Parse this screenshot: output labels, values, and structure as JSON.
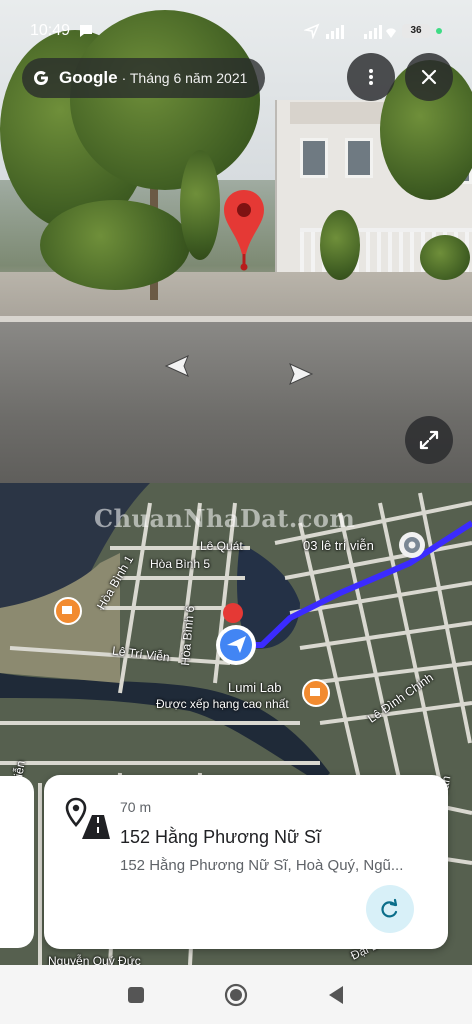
{
  "status_bar": {
    "time": "10:49",
    "battery": "36"
  },
  "streetview": {
    "brand": "Google",
    "date": "· Tháng 6 năm 2021",
    "icons": {
      "menu": "more-vert-icon",
      "close": "close-icon",
      "expand": "expand-icon",
      "pin": "location-pin-icon",
      "nav_left": "chevron-left-icon",
      "nav_right": "chevron-right-icon"
    }
  },
  "map": {
    "watermark": "ChuanNhaDat.com",
    "route_color": "#3b2bff",
    "labels": {
      "le_quat": "Lê Quát",
      "hoa_binh_5": "Hòa Bình 5",
      "hoa_binh_1": "Hòa Bình 1",
      "hoa_binh_6": "Hòa Bình 6",
      "le_tri_vien": "Lê Trí Viễn",
      "destination": "03 lê trí viễn",
      "lumi_lab": "Lumi Lab",
      "lumi_lab_sub": "Được xếp hạng cao nhất",
      "le_dinh_chinh": "Lê Đình Chinh",
      "vien": "Viễn",
      "nguyen": "Nguyễn Quý Đức",
      "tan": "Tân",
      "dai": "Đại Đ"
    }
  },
  "card": {
    "distance": "70 m",
    "title": "152 Hằng Phương Nữ Sĩ",
    "address": "152 Hằng Phương Nữ Sĩ, Hoà Quý, Ngũ...",
    "icons": {
      "place": "place-route-icon",
      "refresh": "refresh-icon"
    }
  },
  "navbar": {
    "icons": [
      "recents-square-icon",
      "home-circle-icon",
      "back-triangle-icon"
    ]
  }
}
